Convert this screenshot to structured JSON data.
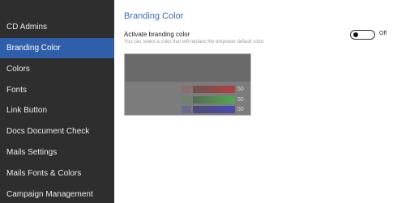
{
  "sidebar": {
    "items": [
      {
        "label": "CD Admins"
      },
      {
        "label": "Branding Color"
      },
      {
        "label": "Colors"
      },
      {
        "label": "Fonts"
      },
      {
        "label": "Link Button"
      },
      {
        "label": "Docs Document Check"
      },
      {
        "label": "Mails Settings"
      },
      {
        "label": "Mails Fonts & Colors"
      },
      {
        "label": "Campaign Management"
      }
    ],
    "active_item": "Branding Color",
    "active_color": "#2f5faa",
    "background_color": "#2e2e2e"
  },
  "main": {
    "title": "Branding Color",
    "setting": {
      "label": "Activate branding color",
      "description": "You can select a color that will replace the empower default color.",
      "toggle_state": "Off"
    },
    "preview": {
      "sliders": [
        {
          "channel": "red",
          "value": "50"
        },
        {
          "channel": "green",
          "value": "50"
        },
        {
          "channel": "blue",
          "value": "50"
        }
      ]
    }
  }
}
